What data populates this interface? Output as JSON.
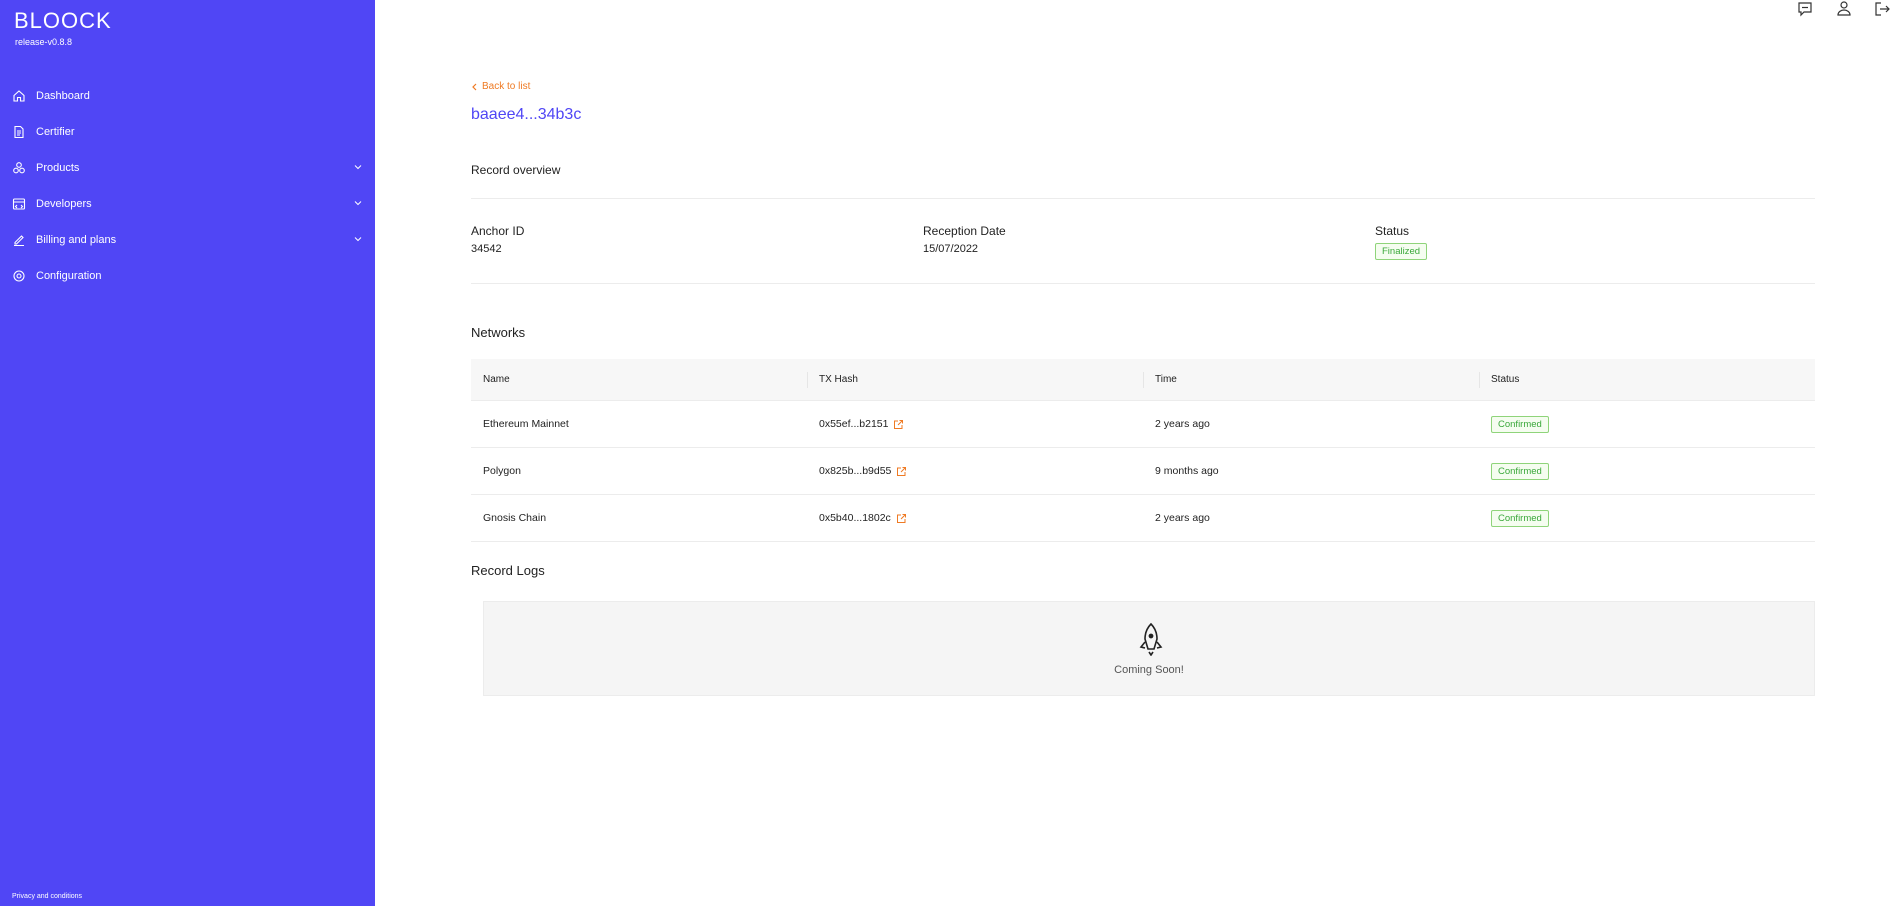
{
  "app": {
    "logo": "BLOOCK",
    "version": "release-v0.8.8"
  },
  "sidebar": {
    "items": [
      {
        "label": "Dashboard",
        "icon": "home-icon"
      },
      {
        "label": "Certifier",
        "icon": "document-icon"
      },
      {
        "label": "Products",
        "icon": "stack-icon",
        "expandable": true
      },
      {
        "label": "Developers",
        "icon": "code-icon",
        "expandable": true
      },
      {
        "label": "Billing and plans",
        "icon": "edit-icon",
        "expandable": true
      },
      {
        "label": "Configuration",
        "icon": "gear-icon"
      }
    ],
    "footer": "Privacy and conditions"
  },
  "topbar": {
    "icons": [
      "chat-icon",
      "user-icon",
      "logout-icon"
    ]
  },
  "record": {
    "back_label": "Back to list",
    "title": "baaee4...34b3c",
    "overview_title": "Record overview",
    "fields": {
      "anchor_label": "Anchor ID",
      "anchor_value": "34542",
      "date_label": "Reception Date",
      "date_value": "15/07/2022",
      "status_label": "Status",
      "status_value": "Finalized"
    }
  },
  "networks": {
    "title": "Networks",
    "columns": [
      "Name",
      "TX Hash",
      "Time",
      "Status"
    ],
    "rows": [
      {
        "name": "Ethereum Mainnet",
        "hash": "0x55ef...b2151",
        "time": "2 years ago",
        "status": "Confirmed"
      },
      {
        "name": "Polygon",
        "hash": "0x825b...b9d55",
        "time": "9 months ago",
        "status": "Confirmed"
      },
      {
        "name": "Gnosis Chain",
        "hash": "0x5b40...1802c",
        "time": "2 years ago",
        "status": "Confirmed"
      }
    ]
  },
  "logs": {
    "title": "Record Logs",
    "coming_soon": "Coming Soon!"
  },
  "colors": {
    "primary": "#5046f5",
    "accent": "#ef7a23",
    "success": "#3aa83a"
  }
}
